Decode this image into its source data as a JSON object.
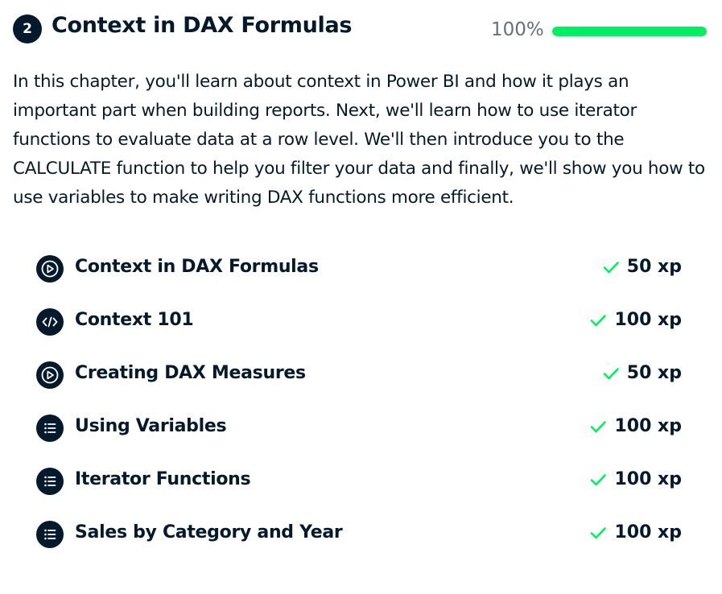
{
  "chapter": {
    "number": "2",
    "title": "Context in DAX Formulas",
    "progress_text": "100%",
    "progress_fraction": 1.0,
    "progress_color": "#03ef62",
    "description": "In this chapter, you'll learn about context in Power BI and how it plays an important part when building reports. Next, we'll learn how to use iterator functions to evaluate data at a row level. We'll then introduce you to the CALCULATE function to help you filter your data and finally, we'll show you how to use variables to make writing DAX functions more efficient."
  },
  "lessons": [
    {
      "title": "Context in DAX Formulas",
      "icon": "video-play-icon",
      "xp": "50 xp",
      "completed": true
    },
    {
      "title": "Context 101",
      "icon": "code-icon",
      "xp": "100 xp",
      "completed": true
    },
    {
      "title": "Creating DAX Measures",
      "icon": "video-play-icon",
      "xp": "50 xp",
      "completed": true
    },
    {
      "title": "Using Variables",
      "icon": "list-icon",
      "xp": "100 xp",
      "completed": true
    },
    {
      "title": "Iterator Functions",
      "icon": "list-icon",
      "xp": "100 xp",
      "completed": true
    },
    {
      "title": "Sales by Category and Year",
      "icon": "list-icon",
      "xp": "100 xp",
      "completed": true
    }
  ],
  "colors": {
    "navy": "#05192d",
    "check_green": "#03ef62",
    "muted_text": "#65707c"
  }
}
